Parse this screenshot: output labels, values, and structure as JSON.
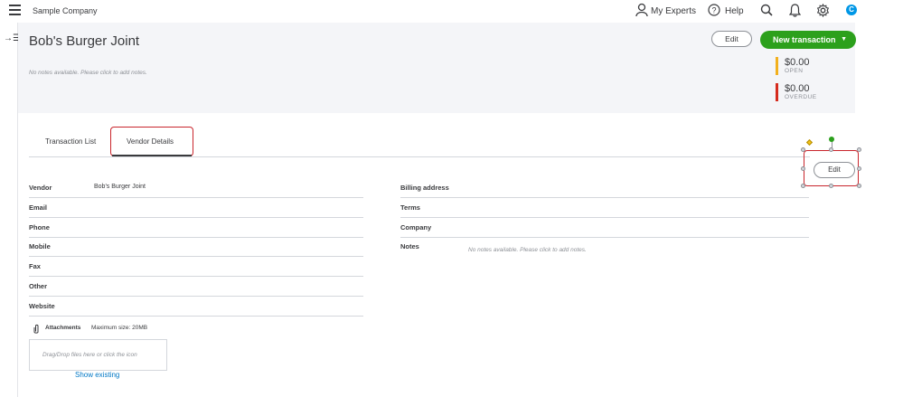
{
  "topbar": {
    "company": "Sample Company",
    "my_experts": "My Experts",
    "help": "Help",
    "avatar_initial": "C"
  },
  "vendor": {
    "name": "Bob's Burger Joint",
    "notes_placeholder": "No notes available. Please click to add notes.",
    "edit_label": "Edit",
    "new_transaction_label": "New transaction",
    "open_amount": "$0.00",
    "open_label": "OPEN",
    "overdue_amount": "$0.00",
    "overdue_label": "OVERDUE"
  },
  "tabs": {
    "transaction_list": "Transaction List",
    "vendor_details": "Vendor Details"
  },
  "details": {
    "edit_label": "Edit",
    "left_fields": [
      {
        "label": "Vendor",
        "value": "Bob's Burger Joint"
      },
      {
        "label": "Email",
        "value": ""
      },
      {
        "label": "Phone",
        "value": ""
      },
      {
        "label": "Mobile",
        "value": ""
      },
      {
        "label": "Fax",
        "value": ""
      },
      {
        "label": "Other",
        "value": ""
      },
      {
        "label": "Website",
        "value": ""
      }
    ],
    "right_fields": [
      {
        "label": "Billing address",
        "value": ""
      },
      {
        "label": "Terms",
        "value": ""
      },
      {
        "label": "Company",
        "value": ""
      },
      {
        "label": "Notes",
        "value": "No notes available. Please click to add notes."
      }
    ],
    "attachments_label": "Attachments",
    "attachments_max": "Maximum size: 20MB",
    "dropzone_text": "Drag/Drop files here or click the icon",
    "show_existing": "Show existing"
  },
  "colors": {
    "brand_green": "#2ca01c",
    "open_bar": "#f2b01e",
    "overdue_bar": "#d52b1e",
    "highlight_red": "#c9252c",
    "link_blue": "#0077c5"
  }
}
